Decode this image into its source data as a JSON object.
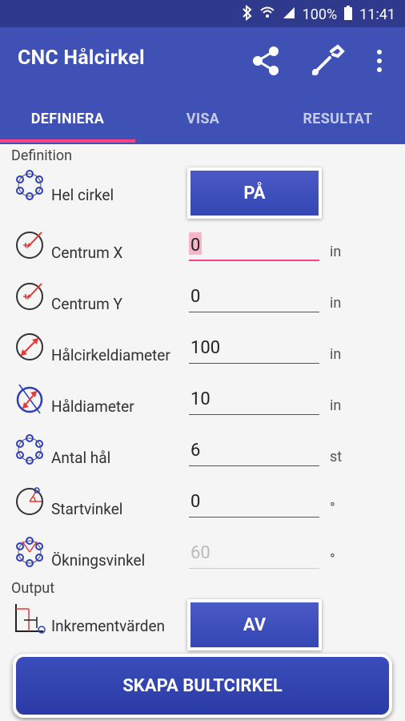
{
  "status": {
    "battery": "100%",
    "time": "11:41"
  },
  "app": {
    "title": "CNC Hålcirkel"
  },
  "icons": {
    "share": "share-icon",
    "settings": "wrench-icon",
    "more": "more-vert-icon"
  },
  "tabs": [
    {
      "label": "DEFINIERA",
      "active": true
    },
    {
      "label": "VISA",
      "active": false
    },
    {
      "label": "RESULTAT",
      "active": false
    }
  ],
  "sections": {
    "definition": "Definition",
    "output": "Output"
  },
  "definition": {
    "full_circle": {
      "label": "Hel cirkel",
      "toggle": "PÅ"
    },
    "center_x": {
      "label": "Centrum X",
      "value": "0",
      "unit": "in"
    },
    "center_y": {
      "label": "Centrum Y",
      "value": "0",
      "unit": "in"
    },
    "bolt_diameter": {
      "label": "Hålcirkeldiameter",
      "value": "100",
      "unit": "in"
    },
    "hole_diameter": {
      "label": "Håldiameter",
      "value": "10",
      "unit": "in"
    },
    "holes": {
      "label": "Antal hål",
      "value": "6",
      "unit": "st"
    },
    "start_angle": {
      "label": "Startvinkel",
      "value": "0",
      "unit": "°"
    },
    "increment_angle": {
      "label": "Ökningsvinkel",
      "value": "60",
      "unit": "°"
    }
  },
  "output": {
    "incremental": {
      "label": "Inkrementvärden",
      "toggle": "AV"
    }
  },
  "actions": {
    "create": "SKAPA BULTCIRKEL"
  },
  "colors": {
    "primary": "#3f51b5",
    "accent": "#ff4081",
    "statusbar": "#2f3a8c"
  }
}
